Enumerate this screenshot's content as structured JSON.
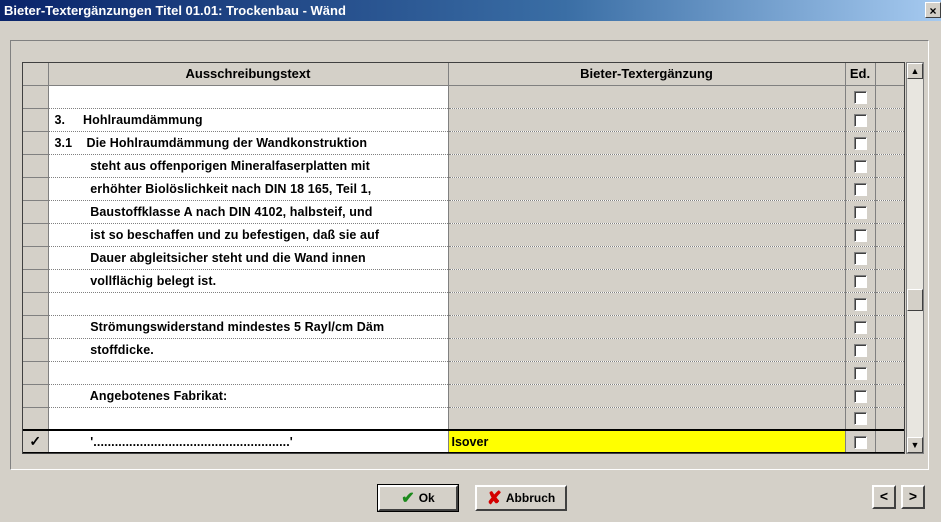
{
  "window": {
    "title": "Bieter-Textergänzungen Titel 01.01: Trockenbau - Wänd",
    "close_label": "×"
  },
  "table": {
    "headers": {
      "text": "Ausschreibungstext",
      "addition": "Bieter-Textergänzung",
      "ed": "Ed."
    },
    "rows": [
      {
        "text": "",
        "addition": ""
      },
      {
        "text": "3.     Hohlraumdämmung",
        "addition": ""
      },
      {
        "text": "3.1    Die Hohlraumdämmung der Wandkonstruktion",
        "addition": ""
      },
      {
        "text": "          steht aus offenporigen Mineralfaserplatten mit",
        "addition": ""
      },
      {
        "text": "          erhöhter Biolöslichkeit nach DIN 18 165, Teil 1,",
        "addition": ""
      },
      {
        "text": "          Baustoffklasse A nach DIN 4102, halbsteif, und",
        "addition": ""
      },
      {
        "text": "          ist so beschaffen und zu befestigen, daß sie auf",
        "addition": ""
      },
      {
        "text": "          Dauer abgleitsicher steht und die Wand innen",
        "addition": ""
      },
      {
        "text": "          vollflächig belegt ist.",
        "addition": ""
      },
      {
        "text": "",
        "addition": ""
      },
      {
        "text": "          Strömungswiderstand mindestes 5 Rayl/cm Däm",
        "addition": ""
      },
      {
        "text": "          stoffdicke.",
        "addition": ""
      },
      {
        "text": "",
        "addition": ""
      },
      {
        "text": "          Angebotenes Fabrikat:",
        "addition": ""
      },
      {
        "text": "",
        "addition": ""
      },
      {
        "text": "          '.......................................................'",
        "addition": "Isover",
        "selected": true,
        "indicator": "✓"
      }
    ]
  },
  "buttons": {
    "ok": "Ok",
    "cancel": "Abbruch",
    "prev": "<",
    "next": ">"
  },
  "scroll": {
    "up": "▲",
    "down": "▼"
  },
  "colors": {
    "highlight": "#ffff00",
    "titlebar": "#0a246a"
  }
}
